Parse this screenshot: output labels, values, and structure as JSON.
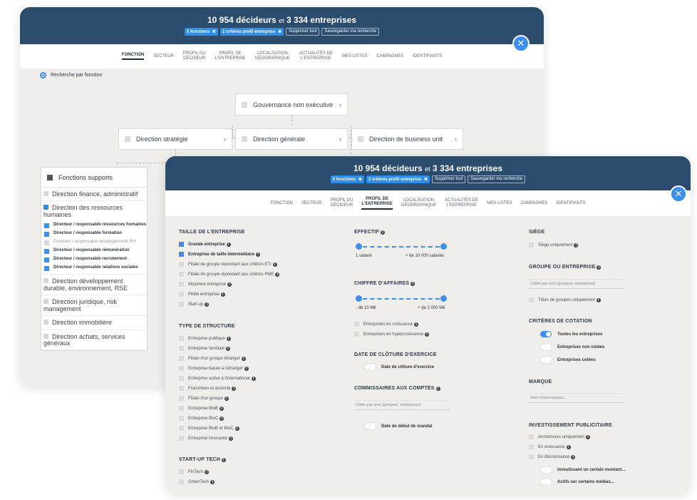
{
  "back_panel": {
    "title_count_people": "10 954 décideurs",
    "title_et": "et",
    "title_count_companies": "3 334 entreprises",
    "chips": [
      "5 fonctions",
      "2 critères profil entreprise"
    ],
    "chip_clear": "Supprimer tout",
    "chip_save": "Sauvegarder ma recherche",
    "tabs": [
      "FONCTION",
      "SECTEUR",
      "PROFIL DU\nDÉCIDEUR",
      "PROFIL DE\nL'ENTREPRISE",
      "LOCALISATION\nGÉOGRAPHIQUE",
      "ACTUALITÉS DE\nL'ENTREPRISE",
      "MES LISTES",
      "CAMPAGNES",
      "IDENTIFIANTS"
    ],
    "active_tab": 0,
    "radio_label": "Recherche par fonction",
    "tree": {
      "top": "Gouvernance non exécutive",
      "left": "Direction stratégie",
      "center": "Direction générale",
      "right": "Direction de business unit"
    },
    "supports": {
      "title": "Fonctions supports",
      "groups": [
        {
          "label": "Direction finance, administratif",
          "open": false
        },
        {
          "label": "Direction des ressources humaines",
          "open": true,
          "items": [
            {
              "label": "Directeur / responsable ressources humaines",
              "checked": true
            },
            {
              "label": "Directeur / responsable formation",
              "checked": true
            },
            {
              "label": "Directeur / responsable développement RH",
              "checked": false
            },
            {
              "label": "Directeur / responsable rémunération",
              "checked": true
            },
            {
              "label": "Directeur / responsable recrutement",
              "checked": true
            },
            {
              "label": "Directeur / responsable relations sociales",
              "checked": true
            }
          ]
        },
        {
          "label": "Direction développement durable, environnement, RSE",
          "open": false
        },
        {
          "label": "Direction juridique, risk management",
          "open": false
        },
        {
          "label": "Direction immobilière",
          "open": false
        },
        {
          "label": "Direction achats, services généraux",
          "open": false
        }
      ]
    }
  },
  "front_panel": {
    "title_count_people": "10 954 décideurs",
    "title_et": "et",
    "title_count_companies": "3 334 entreprises",
    "chips": [
      "5 fonctions",
      "2 critères profil entreprise"
    ],
    "chip_clear": "Supprimer tout",
    "chip_save": "Sauvegarder ma recherche",
    "tabs": [
      "FONCTION",
      "SECTEUR",
      "PROFIL DU\nDÉCIDEUR",
      "PROFIL DE\nL'ENTREPRISE",
      "LOCALISATION\nGÉOGRAPHIQUE",
      "ACTUALITÉS DE\nL'ENTREPRISE",
      "MES LISTES",
      "CAMPAGNES",
      "IDENTIFIANTS"
    ],
    "active_tab": 3,
    "taille": {
      "title": "TAILLE DE L'ENTREPRISE",
      "items": [
        {
          "label": "Grande entreprise",
          "checked": true,
          "info": true
        },
        {
          "label": "Entreprise de taille intermédiaire",
          "checked": true,
          "info": true
        },
        {
          "label": "Filiale de groupe répondant aux critères ETI",
          "checked": false,
          "info": true
        },
        {
          "label": "Filiale de groupe répondant aux critères PME",
          "checked": false,
          "info": true
        },
        {
          "label": "Moyenne entreprise",
          "checked": false,
          "info": true
        },
        {
          "label": "Petite entreprise",
          "checked": false,
          "info": true
        },
        {
          "label": "Start-up",
          "checked": false,
          "info": true
        }
      ]
    },
    "structure": {
      "title": "TYPE DE STRUCTURE",
      "items": [
        {
          "label": "Entreprise publique",
          "info": true
        },
        {
          "label": "Entreprise familiale",
          "info": true
        },
        {
          "label": "Filiale d'un groupe étranger",
          "info": true
        },
        {
          "label": "Entreprise basée à l'étranger",
          "info": true
        },
        {
          "label": "Entreprise active à l'international",
          "info": true
        },
        {
          "label": "Franchises et assimilé",
          "info": true
        },
        {
          "label": "Filiale d'un groupe",
          "info": true
        },
        {
          "label": "Entreprise BtoB",
          "info": true
        },
        {
          "label": "Entreprise BtoC",
          "info": true
        },
        {
          "label": "Entreprise BtoB et BtoC",
          "info": true
        },
        {
          "label": "Entreprise innovante",
          "info": true
        }
      ]
    },
    "startup": {
      "title": "START-UP TECH",
      "items": [
        {
          "label": "FinTech",
          "info": true
        },
        {
          "label": "GreenTech",
          "info": true
        }
      ]
    },
    "effectif": {
      "title": "EFFECTIF",
      "min_label": "1 salarié",
      "max_label": "+ de 10 000 salariés",
      "range": [
        0,
        1
      ]
    },
    "ca": {
      "title": "CHIFFRE D'AFFAIRES",
      "min_label": "- de 10 M€",
      "max_label": "+ de 2 000 M€",
      "range": [
        0,
        1
      ],
      "items": [
        {
          "label": "Entreprises en croissance",
          "info": true
        },
        {
          "label": "Entreprises en hypercroissance",
          "info": true
        }
      ]
    },
    "cloture": {
      "title": "DATE DE CLÔTURE D'EXERCICE",
      "toggle_label": "Date de clôture d'exercice"
    },
    "commissaires": {
      "title": "COMMISSAIRES AUX COMPTES",
      "placeholder": "Cibler par nom (groupes, entreprises)",
      "toggle_label": "Date de début de mandat"
    },
    "siege": {
      "title": "SIÈGE",
      "item": "Siège uniquement"
    },
    "groupe": {
      "title": "GROUPE OU ENTREPRISE",
      "placeholder": "Cibler par nom (groupes, entreprises)",
      "item": "Têtes de groupes uniquement"
    },
    "cotation": {
      "title": "CRITÈRES DE COTATION",
      "items": [
        {
          "label": "Toutes les entreprises",
          "on": true
        },
        {
          "label": "Entreprises non cotées",
          "on": false
        },
        {
          "label": "Entreprises cotées",
          "on": false
        }
      ]
    },
    "marque": {
      "title": "MARQUE",
      "placeholder": "Nom d'une marque..."
    },
    "pub": {
      "title": "INVESTISSEMENT PUBLICITAIRE",
      "items": [
        {
          "label": "Annonceurs uniquement",
          "info": true
        },
        {
          "label": "En croissance",
          "info": true
        },
        {
          "label": "En décroissance",
          "info": true
        }
      ],
      "toggles": [
        "Investissant un certain montant...",
        "Actifs sur certains médias..."
      ]
    }
  },
  "colors": {
    "header": "#2b4c6d",
    "accent": "#3d8fef",
    "bg": "#efeeea"
  }
}
